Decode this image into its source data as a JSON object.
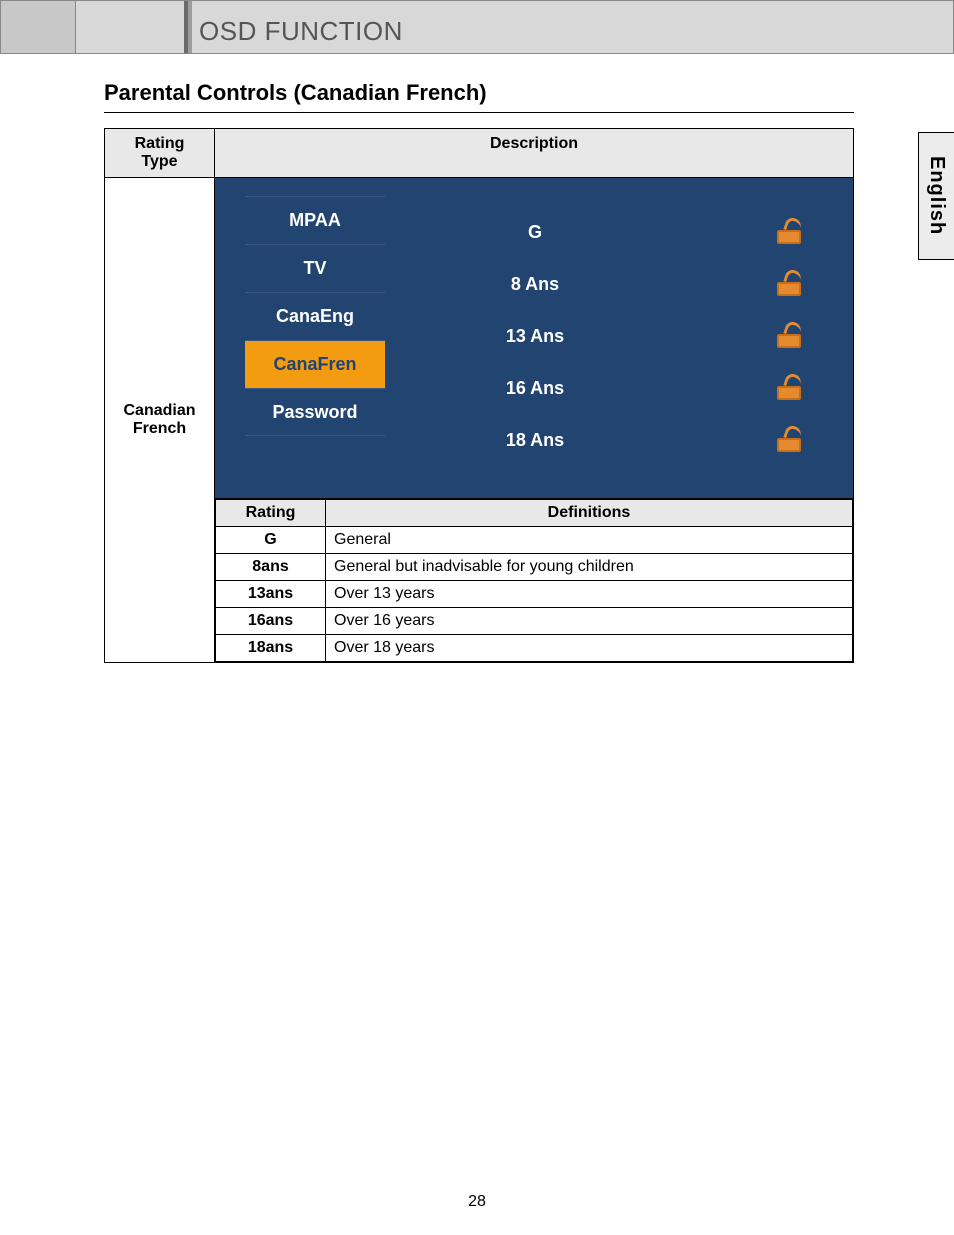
{
  "header": {
    "title": "OSD FUNCTION"
  },
  "section": {
    "title": "Parental Controls (Canadian French)"
  },
  "table": {
    "headers": {
      "rating_type": "Rating\nType",
      "description": "Description"
    },
    "row_label": "Canadian\nFrench",
    "sub_headers": {
      "rating": "Rating",
      "definitions": "Definitions"
    },
    "definitions": [
      {
        "rating": "G",
        "def": "General"
      },
      {
        "rating": "8ans",
        "def": "General but inadvisable for young children"
      },
      {
        "rating": "13ans",
        "def": "Over 13 years"
      },
      {
        "rating": "16ans",
        "def": "Over 16 years"
      },
      {
        "rating": "18ans",
        "def": "Over 18 years"
      }
    ]
  },
  "osd": {
    "menu": [
      {
        "label": "MPAA",
        "active": false
      },
      {
        "label": "TV",
        "active": false
      },
      {
        "label": "CanaEng",
        "active": false
      },
      {
        "label": "CanaFren",
        "active": true
      },
      {
        "label": "Password",
        "active": false
      }
    ],
    "ratings": [
      "G",
      "8 Ans",
      "13 Ans",
      "16 Ans",
      "18 Ans"
    ]
  },
  "side_tab": "English",
  "page_number": "28"
}
